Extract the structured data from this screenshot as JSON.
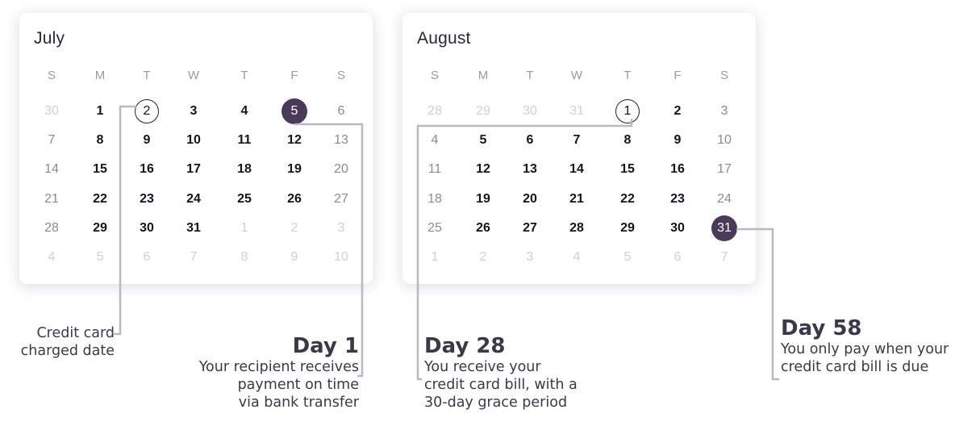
{
  "weekdays": [
    "S",
    "M",
    "T",
    "W",
    "T",
    "F",
    "S"
  ],
  "months": [
    {
      "name": "July",
      "days": [
        [
          [
            "30",
            "out"
          ],
          [
            "1",
            "in"
          ],
          [
            "2",
            "ring"
          ],
          [
            "3",
            "in"
          ],
          [
            "4",
            "in"
          ],
          [
            "5",
            "fill"
          ],
          [
            "6",
            "wk"
          ]
        ],
        [
          [
            "7",
            "wk"
          ],
          [
            "8",
            "in"
          ],
          [
            "9",
            "in"
          ],
          [
            "10",
            "in"
          ],
          [
            "11",
            "in"
          ],
          [
            "12",
            "in"
          ],
          [
            "13",
            "wk"
          ]
        ],
        [
          [
            "14",
            "wk"
          ],
          [
            "15",
            "in"
          ],
          [
            "16",
            "in"
          ],
          [
            "17",
            "in"
          ],
          [
            "18",
            "in"
          ],
          [
            "19",
            "in"
          ],
          [
            "20",
            "wk"
          ]
        ],
        [
          [
            "21",
            "wk"
          ],
          [
            "22",
            "in"
          ],
          [
            "23",
            "in"
          ],
          [
            "24",
            "in"
          ],
          [
            "25",
            "in"
          ],
          [
            "26",
            "in"
          ],
          [
            "27",
            "wk"
          ]
        ],
        [
          [
            "28",
            "wk"
          ],
          [
            "29",
            "in"
          ],
          [
            "30",
            "in"
          ],
          [
            "31",
            "in"
          ],
          [
            "1",
            "out"
          ],
          [
            "2",
            "out"
          ],
          [
            "3",
            "out"
          ]
        ],
        [
          [
            "4",
            "out"
          ],
          [
            "5",
            "out"
          ],
          [
            "6",
            "out"
          ],
          [
            "7",
            "out"
          ],
          [
            "8",
            "out"
          ],
          [
            "9",
            "out"
          ],
          [
            "10",
            "out"
          ]
        ]
      ]
    },
    {
      "name": "August",
      "days": [
        [
          [
            "28",
            "out"
          ],
          [
            "29",
            "out"
          ],
          [
            "30",
            "out"
          ],
          [
            "31",
            "out"
          ],
          [
            "1",
            "ring"
          ],
          [
            "2",
            "in"
          ],
          [
            "3",
            "wk"
          ]
        ],
        [
          [
            "4",
            "wk"
          ],
          [
            "5",
            "in"
          ],
          [
            "6",
            "in"
          ],
          [
            "7",
            "in"
          ],
          [
            "8",
            "in"
          ],
          [
            "9",
            "in"
          ],
          [
            "10",
            "wk"
          ]
        ],
        [
          [
            "11",
            "wk"
          ],
          [
            "12",
            "in"
          ],
          [
            "13",
            "in"
          ],
          [
            "14",
            "in"
          ],
          [
            "15",
            "in"
          ],
          [
            "16",
            "in"
          ],
          [
            "17",
            "wk"
          ]
        ],
        [
          [
            "18",
            "wk"
          ],
          [
            "19",
            "in"
          ],
          [
            "20",
            "in"
          ],
          [
            "21",
            "in"
          ],
          [
            "22",
            "in"
          ],
          [
            "23",
            "in"
          ],
          [
            "24",
            "wk"
          ]
        ],
        [
          [
            "25",
            "wk"
          ],
          [
            "26",
            "in"
          ],
          [
            "27",
            "in"
          ],
          [
            "28",
            "in"
          ],
          [
            "29",
            "in"
          ],
          [
            "30",
            "in"
          ],
          [
            "31",
            "fill"
          ]
        ],
        [
          [
            "1",
            "out"
          ],
          [
            "2",
            "out"
          ],
          [
            "3",
            "out"
          ],
          [
            "4",
            "out"
          ],
          [
            "5",
            "out"
          ],
          [
            "6",
            "out"
          ],
          [
            "7",
            "out"
          ]
        ]
      ]
    }
  ],
  "annotations": {
    "charged": {
      "line1": "Credit card",
      "line2": "charged date"
    },
    "day1": {
      "heading": "Day 1",
      "line1": "Your recipient receives",
      "line2": "payment on time",
      "line3": "via bank transfer"
    },
    "day28": {
      "heading": "Day 28",
      "line1": "You receive your",
      "line2": "credit card bill, with a",
      "line3": "30-day grace period"
    },
    "day58": {
      "heading": "Day 58",
      "line1": "You only pay when your",
      "line2": "credit card bill is due"
    }
  },
  "colors": {
    "highlight": "#4a3a58",
    "leader_line": "#b9b9be",
    "text_dark": "#15131f",
    "weekend": "#8a8a92",
    "outside": "#cfcfd4"
  }
}
